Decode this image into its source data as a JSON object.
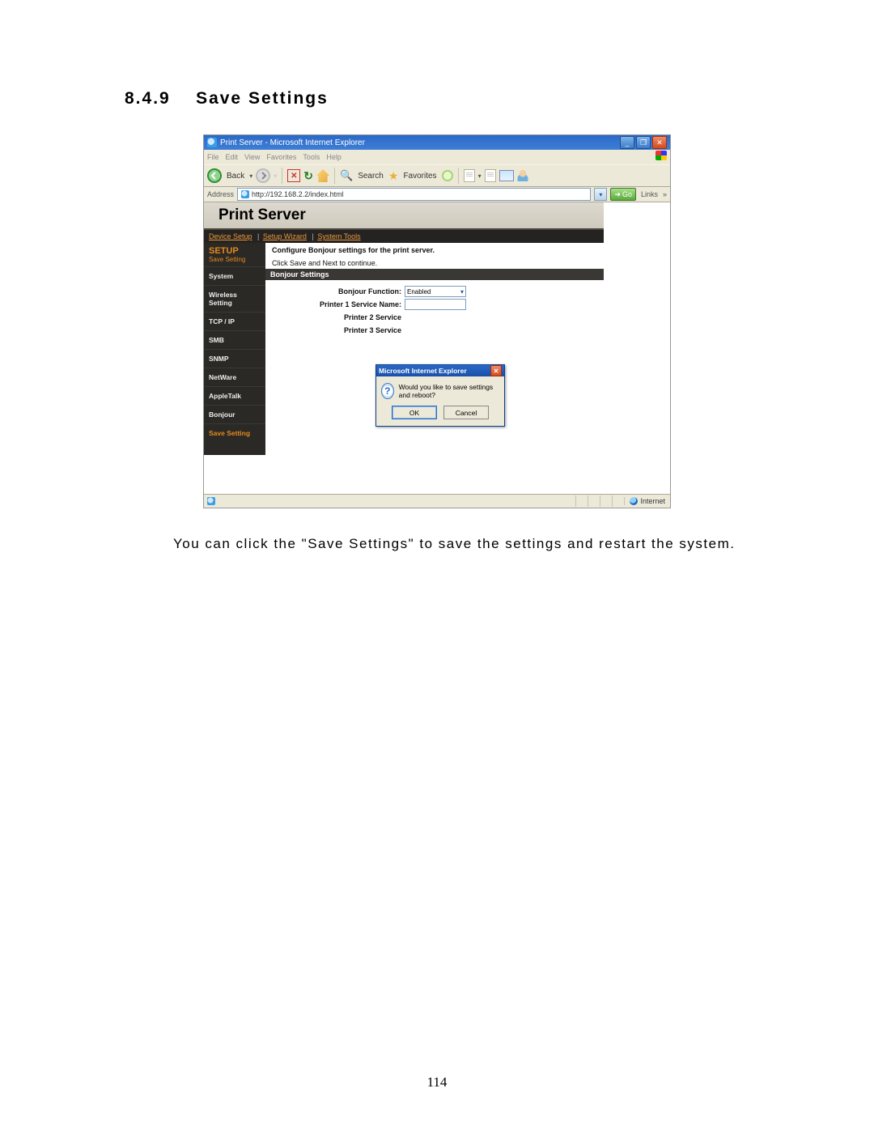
{
  "doc": {
    "section_number": "8.4.9",
    "section_title": "Save Settings",
    "body_paragraph": "You can click the \"Save Settings\" to save the settings and restart the system.",
    "page_number": "114"
  },
  "browser": {
    "window_title": "Print Server - Microsoft Internet Explorer",
    "menu": {
      "file": "File",
      "edit": "Edit",
      "view": "View",
      "favorites": "Favorites",
      "tools": "Tools",
      "help": "Help"
    },
    "toolbar": {
      "back": "Back",
      "search": "Search",
      "favorites": "Favorites"
    },
    "address_label": "Address",
    "address_value": "http://192.168.2.2/index.html",
    "go_label": "Go",
    "links_label": "Links",
    "status_zone": "Internet"
  },
  "app": {
    "header_title": "Print Server",
    "tabs": {
      "device_setup": "Device Setup",
      "setup_wizard": "Setup Wizard",
      "system_tools": "System Tools"
    },
    "sidebar": {
      "setup_head": "SETUP",
      "setup_sub": "Save Setting",
      "items": [
        {
          "label": "System"
        },
        {
          "label": "Wireless Setting"
        },
        {
          "label": "TCP / IP"
        },
        {
          "label": "SMB"
        },
        {
          "label": "SNMP"
        },
        {
          "label": "NetWare"
        },
        {
          "label": "AppleTalk"
        },
        {
          "label": "Bonjour"
        },
        {
          "label": "Save Setting"
        }
      ]
    },
    "content": {
      "cfg_line": "Configure Bonjour settings for the print server.",
      "cfg_hint": "Click Save and Next to continue.",
      "section_bar": "Bonjour Settings",
      "rows": {
        "func_label": "Bonjour Function:",
        "func_value": "Enabled",
        "p1_label": "Printer 1 Service Name:",
        "p2_label": "Printer 2 Service",
        "p3_label": "Printer 3 Service"
      }
    }
  },
  "dialog": {
    "title": "Microsoft Internet Explorer",
    "message": "Would you like to save settings and reboot?",
    "ok": "OK",
    "cancel": "Cancel"
  }
}
